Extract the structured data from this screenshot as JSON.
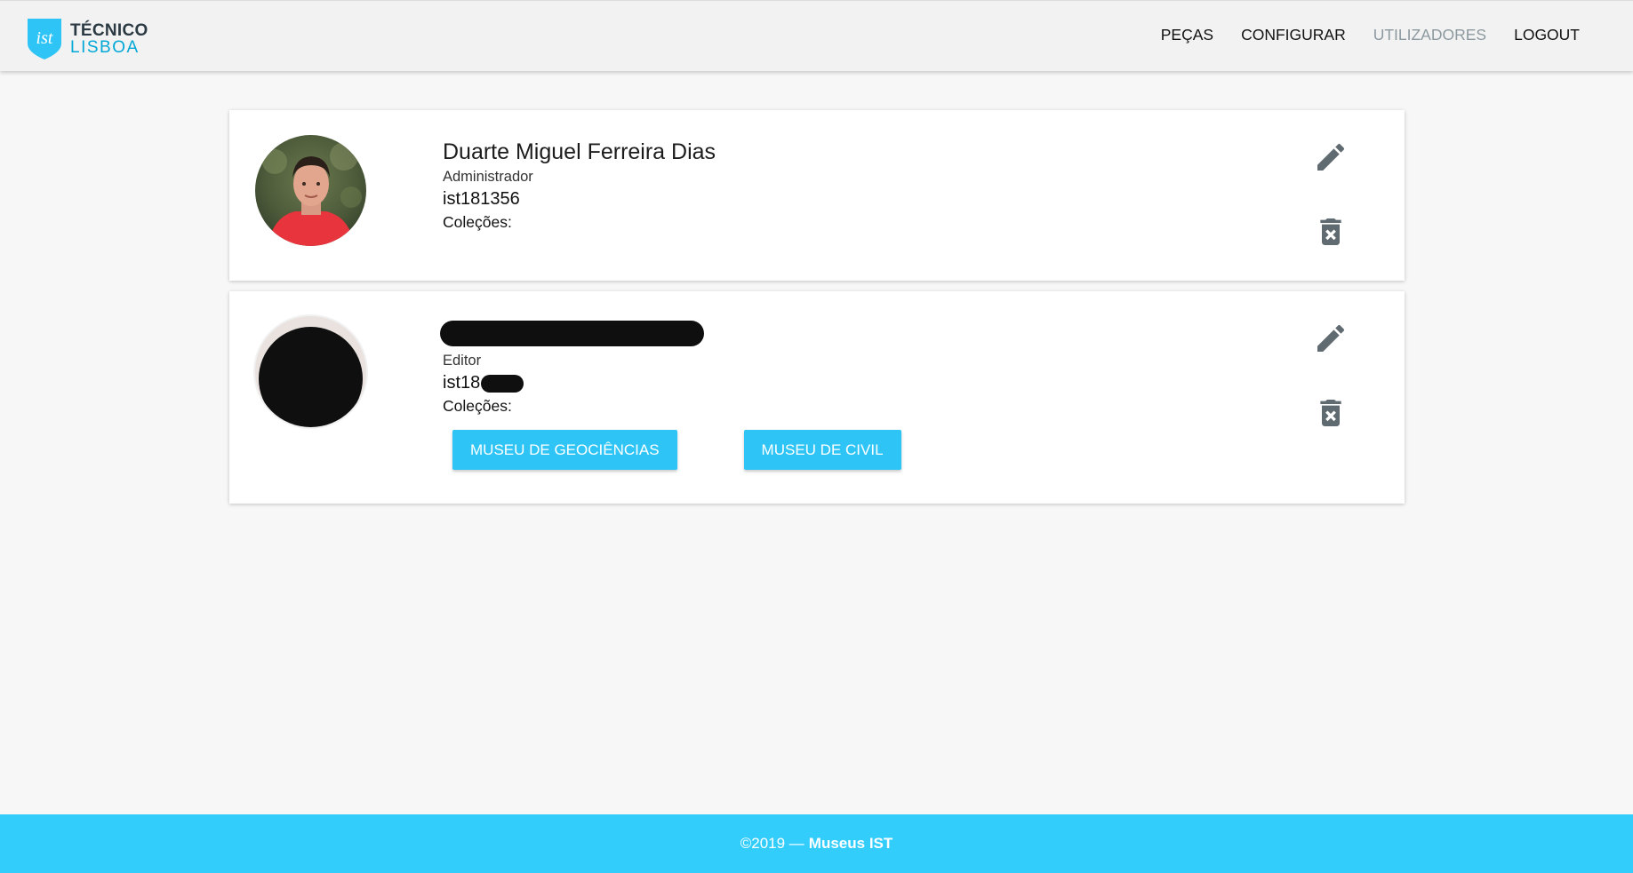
{
  "brand": {
    "line1": "TÉCNICO",
    "line2": "LISBOA",
    "mark": "ist",
    "color": "#2ec5f6"
  },
  "nav": {
    "items": [
      {
        "label": "PEÇAS",
        "active": false
      },
      {
        "label": "CONFIGURAR",
        "active": false
      },
      {
        "label": "UTILIZADORES",
        "active": true
      },
      {
        "label": "LOGOUT",
        "active": false
      }
    ]
  },
  "users": [
    {
      "name": "Duarte Miguel Ferreira Dias",
      "role": "Administrador",
      "uid": "ist181356",
      "collections_label": "Coleções:",
      "collections": [],
      "edit_icon": "pencil-icon",
      "delete_icon": "trash-icon"
    },
    {
      "name_redacted": true,
      "role": "Editor",
      "uid_prefix": "ist18",
      "collections_label": "Coleções:",
      "collections": [
        "MUSEU DE GEOCIÊNCIAS",
        "MUSEU DE CIVIL"
      ],
      "edit_icon": "pencil-icon",
      "delete_icon": "trash-icon"
    }
  ],
  "footer": {
    "prefix": "©2019 —",
    "brand": "Museus IST",
    "color": "#33cdfc"
  }
}
